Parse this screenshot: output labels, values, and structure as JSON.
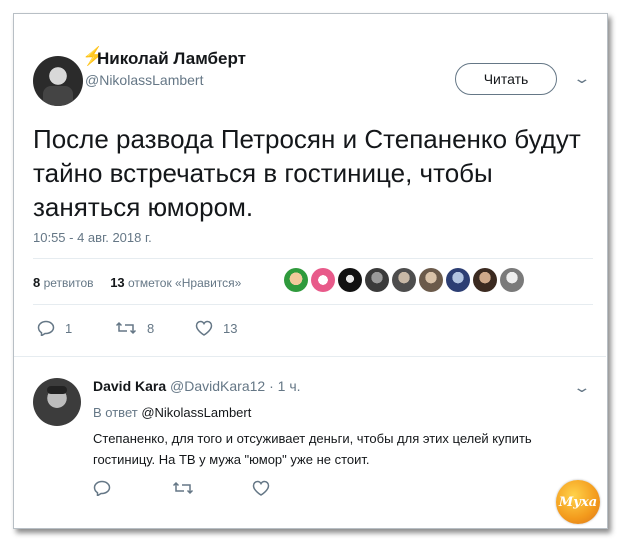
{
  "tweet": {
    "author_name": "Николай Ламберт",
    "author_handle": "@NikolassLambert",
    "follow_label": "Читать",
    "text": "После развода Петросян и Степаненко будут тайно встречаться в гостинице, чтобы заняться юмором.",
    "timestamp": "10:55 - 4 авг. 2018 г.",
    "retweets_count": "8",
    "retweets_label": "ретвитов",
    "likes_count": "13",
    "likes_label": "отметок «Нравится»",
    "actions": {
      "reply_count": "1",
      "retweet_count": "8",
      "like_count": "13"
    }
  },
  "reply": {
    "author_name": "David Kara",
    "author_handle": "@DavidKara12",
    "time": "· 1 ч.",
    "in_reply_prefix": "В ответ",
    "in_reply_handle": "@NikolassLambert",
    "text": "Степаненко, для того и отсуживает деньги, чтобы для этих целей купить гостиницу. На ТВ у мужа \"юмор\" уже не стоит."
  },
  "watermark": "Муха",
  "colors": {
    "text": "#14171a",
    "secondary": "#657786",
    "divider": "#e6ecf0",
    "accent_bolt": "#f5a623"
  },
  "icons": [
    "lightning-icon",
    "chevron-down-icon",
    "reply-icon",
    "retweet-icon",
    "like-icon"
  ]
}
